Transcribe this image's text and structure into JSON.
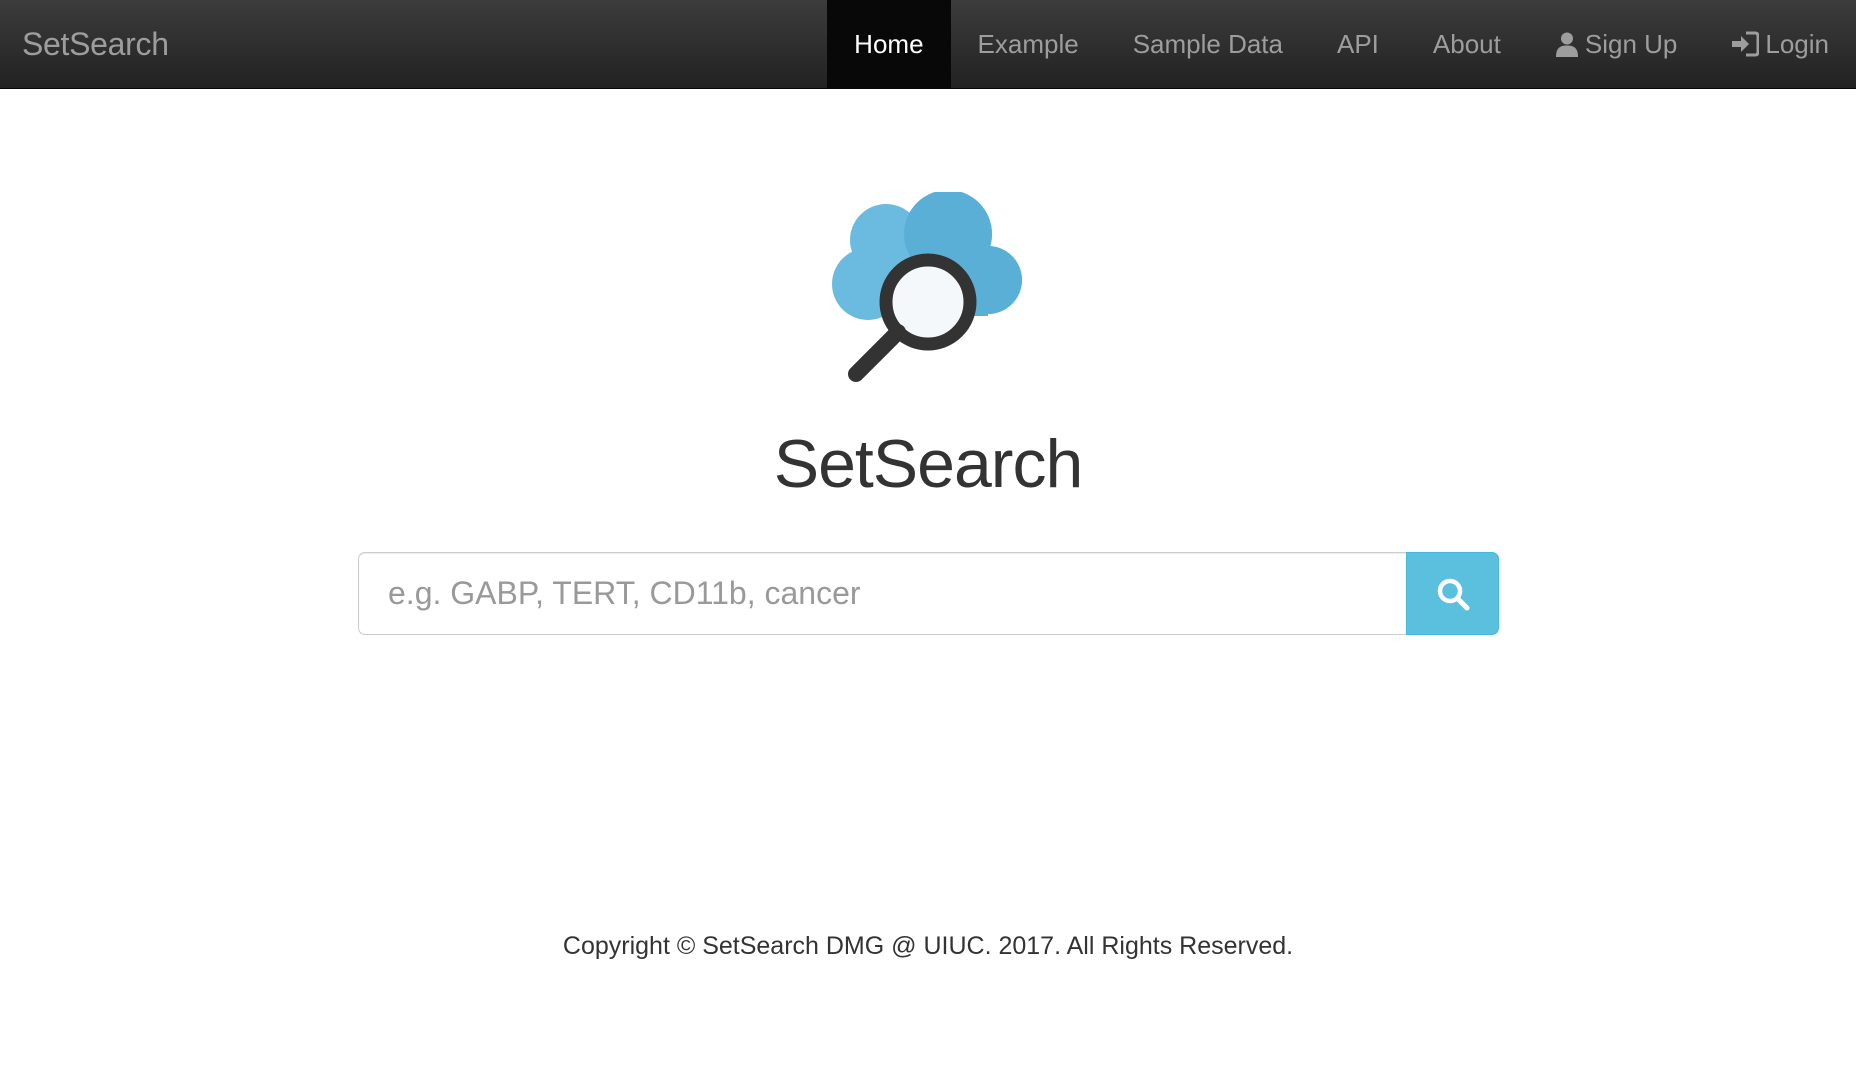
{
  "navbar": {
    "brand": "SetSearch",
    "items": [
      {
        "label": "Home",
        "active": true
      },
      {
        "label": "Example",
        "active": false
      },
      {
        "label": "Sample Data",
        "active": false
      },
      {
        "label": "API",
        "active": false
      },
      {
        "label": "About",
        "active": false
      },
      {
        "label": "Sign Up",
        "icon": "user-icon",
        "active": false
      },
      {
        "label": "Login",
        "icon": "login-icon",
        "active": false
      }
    ]
  },
  "hero": {
    "logo_icon": "cloud-search-logo",
    "title": "SetSearch"
  },
  "search": {
    "placeholder": "e.g. GABP, TERT, CD11b, cancer",
    "value": "",
    "button_icon": "search-icon"
  },
  "footer": {
    "text": "Copyright © SetSearch DMG @ UIUC. 2017. All Rights Reserved."
  },
  "colors": {
    "navbar_bg": "#222222",
    "navbar_active_bg": "#080808",
    "navbar_text": "#9d9d9d",
    "accent": "#5bc0de",
    "cloud": "#5fb4da",
    "text": "#333333"
  }
}
